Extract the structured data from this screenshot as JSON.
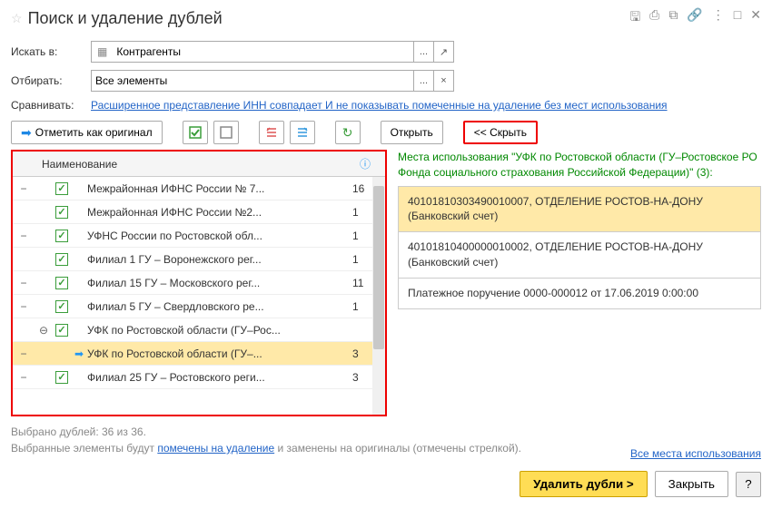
{
  "title": "Поиск и удаление дублей",
  "search_in": {
    "label": "Искать в:",
    "value": "Контрагенты"
  },
  "filter": {
    "label": "Отбирать:",
    "value": "Все элементы"
  },
  "compare": {
    "label": "Сравнивать:",
    "link": "Расширенное представление ИНН совпадает И не показывать помеченные на удаление без мест использования"
  },
  "toolbar": {
    "mark_original": "Отметить как оригинал",
    "open": "Открыть",
    "hide": "<< Скрыть"
  },
  "table": {
    "header_name": "Наименование",
    "rows": [
      {
        "toggle": "−",
        "checked": true,
        "name": "Межрайонная ИФНС России № 7...",
        "count": "16"
      },
      {
        "toggle": "",
        "checked": true,
        "name": "Межрайонная ИФНС России №2...",
        "count": "1"
      },
      {
        "toggle": "−",
        "checked": true,
        "name": "УФНС России по Ростовской обл...",
        "count": "1"
      },
      {
        "toggle": "",
        "checked": true,
        "name": "Филиал 1 ГУ – Воронежского рег...",
        "count": "1"
      },
      {
        "toggle": "−",
        "checked": true,
        "name": "Филиал 15 ГУ – Московского рег...",
        "count": "11"
      },
      {
        "toggle": "−",
        "checked": true,
        "name": "Филиал 5 ГУ – Свердловского ре...",
        "count": "1"
      },
      {
        "toggle": "",
        "expand": "⊖",
        "checked": true,
        "name": "УФК по Ростовской области (ГУ–Рос...",
        "count": "",
        "indent": 0
      },
      {
        "toggle": "−",
        "arrow": true,
        "name": "УФК по Ростовской области (ГУ–...",
        "count": "3",
        "selected": true
      },
      {
        "toggle": "−",
        "checked": true,
        "name": "Филиал 25 ГУ – Ростовского реги...",
        "count": "3"
      }
    ]
  },
  "usages": {
    "header": "Места использования \"УФК по Ростовской области (ГУ–Ростовское РО Фонда социального страхования  Российской Федерации)\" (3):",
    "items": [
      {
        "text": "40101810303490010007, ОТДЕЛЕНИЕ РОСТОВ-НА-ДОНУ (Банковский счет)",
        "selected": true
      },
      {
        "text": "40101810400000010002, ОТДЕЛЕНИЕ РОСТОВ-НА-ДОНУ (Банковский счет)"
      },
      {
        "text": "Платежное поручение 0000-000012 от 17.06.2019 0:00:00"
      }
    ]
  },
  "footer": {
    "selected_count": "Выбрано дублей: 36 из 36.",
    "note_prefix": "Выбранные элементы будут ",
    "note_link": "помечены на удаление",
    "note_suffix": " и заменены на оригиналы (отмечены стрелкой).",
    "all_usages": "Все места использования"
  },
  "buttons": {
    "delete": "Удалить дубли >",
    "close": "Закрыть",
    "help": "?"
  }
}
